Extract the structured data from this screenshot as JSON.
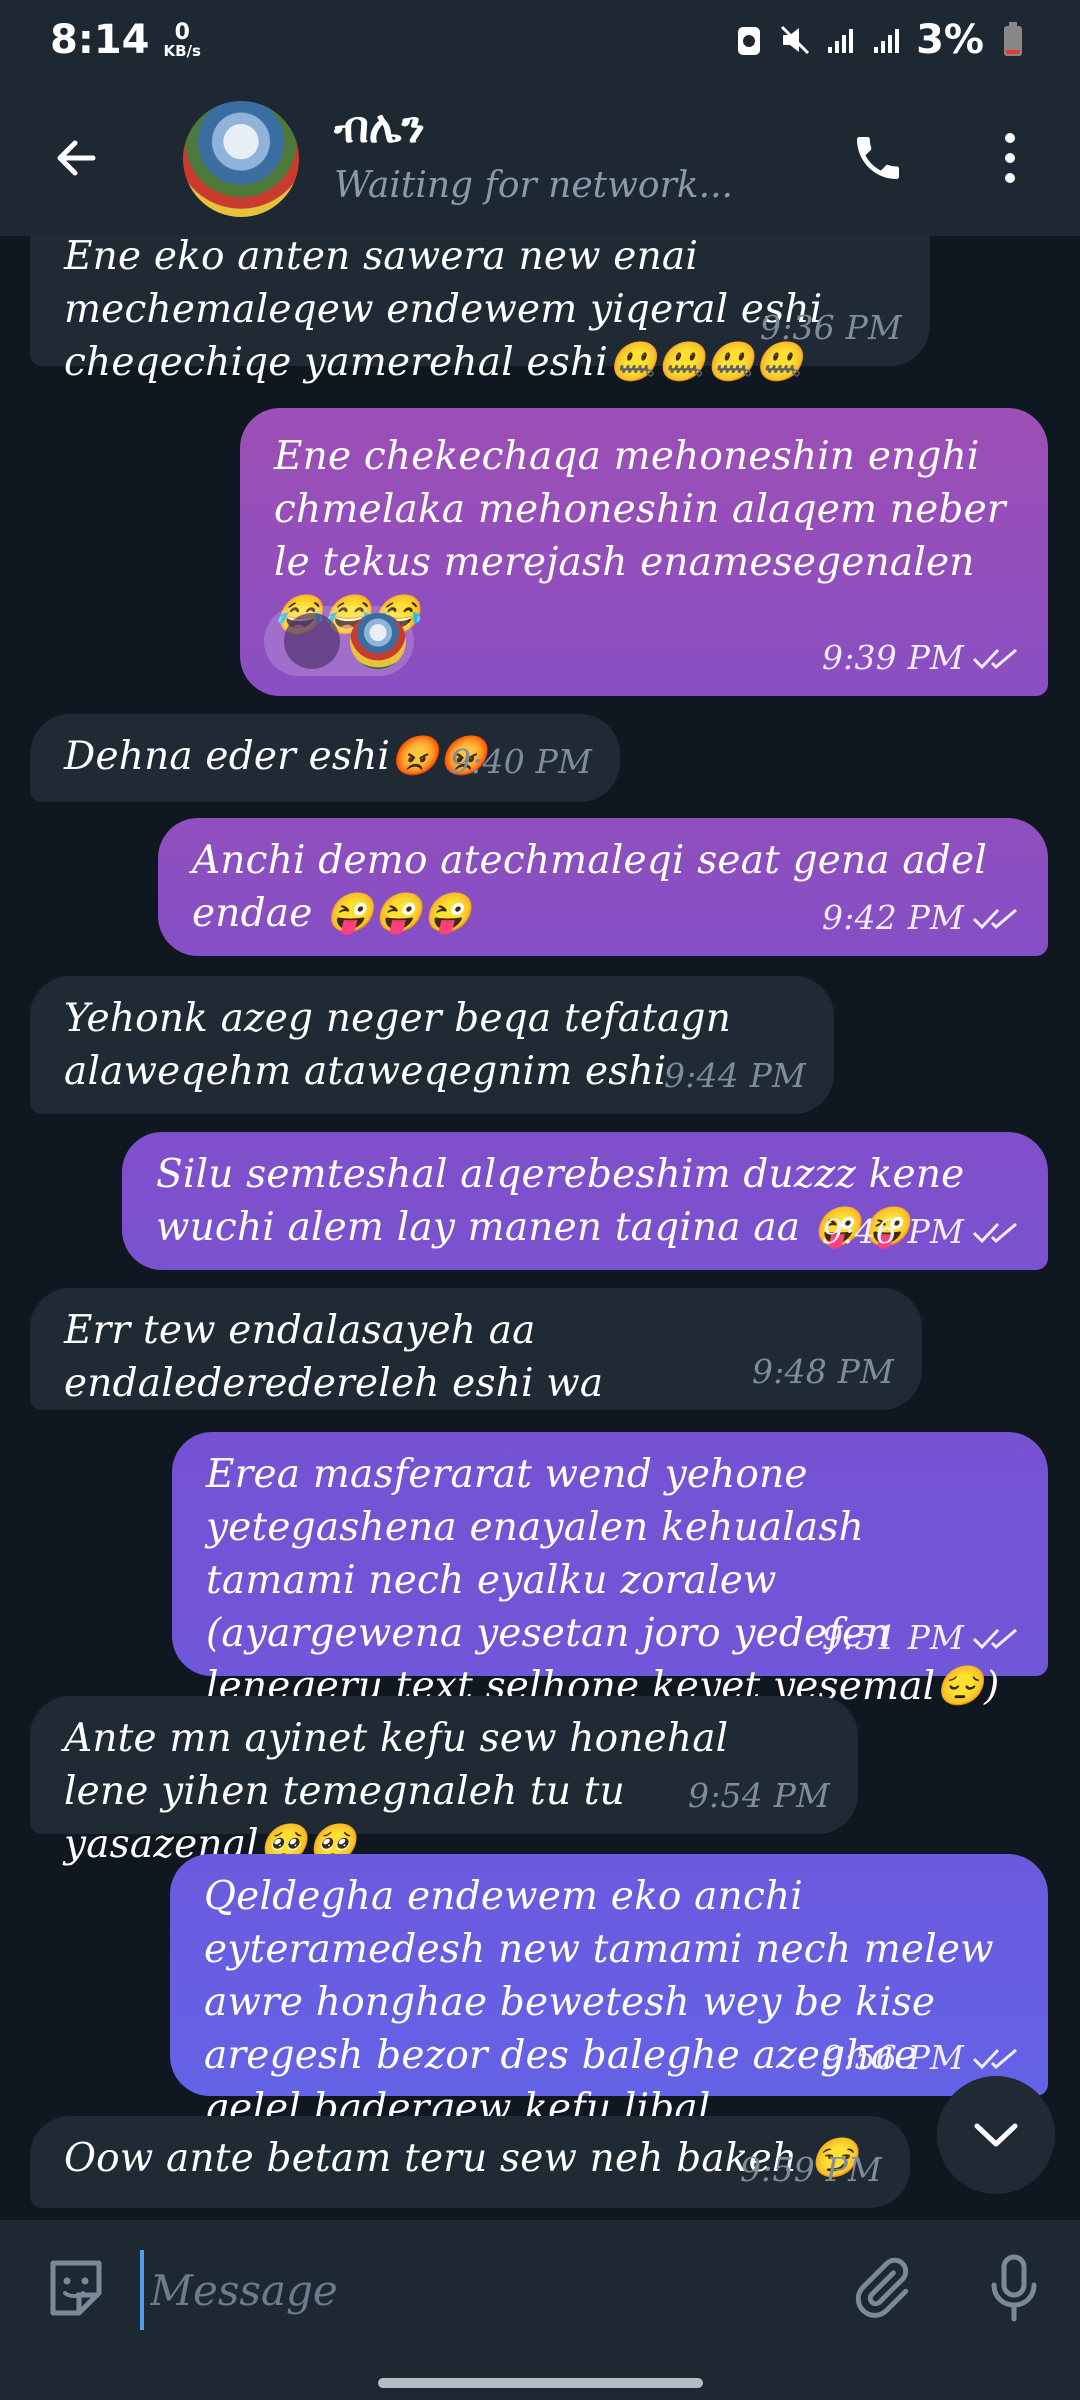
{
  "status_bar": {
    "time": "8:14",
    "speed_value": "0",
    "speed_unit": "KB/s",
    "battery": "3%"
  },
  "header": {
    "contact_name": "ብሌን",
    "status": "Waiting for network..."
  },
  "messages": [
    {
      "dir": "in",
      "text": "Ene eko anten sawera new enai mechemaleqew endewem yiqeral eshi cheqechiqe yamerehal eshi🤐🤐🤐🤐",
      "time": "9:36 PM"
    },
    {
      "dir": "out",
      "text": "Ene chekechaqa mehoneshin enghi chmelaka mehoneshin alaqem neber le tekus merejash enamesegenalen 😂😂😂",
      "time": "9:39 PM"
    },
    {
      "dir": "in",
      "text": "Dehna eder eshi😡😡",
      "time": "9:40 PM"
    },
    {
      "dir": "out",
      "text": "Anchi demo atechmaleqi seat gena adel endae 😜😜😜",
      "time": "9:42 PM"
    },
    {
      "dir": "in",
      "text": "Yehonk azeg neger beqa tefatagn alaweqehm ataweqegnim eshi",
      "time": "9:44 PM"
    },
    {
      "dir": "out",
      "text": "Silu semteshal alqerebeshim duzzz kene wuchi alem lay manen taqina aa 😜😜",
      "time": "9:46 PM"
    },
    {
      "dir": "in",
      "text": "Err tew endalasayeh aa endalederedereleh eshi wa",
      "time": "9:48 PM"
    },
    {
      "dir": "out",
      "text": "Erea masferarat wend yehone yetegashena enayalen kehualash tamami nech eyalku zoralew (ayargewena yesetan joro yedefen lenegeru text selhone keyet yesemal😔)",
      "time": "9:51 PM"
    },
    {
      "dir": "in",
      "text": "Ante mn ayinet kefu sew honehal lene yihen temegnaleh tu tu yasazenal🥺🥺",
      "time": "9:54 PM"
    },
    {
      "dir": "out",
      "text": "Qeldegha endewem eko anchi eyteramedesh new tamami nech melew awre honghae bewetesh wey be kise aregesh bezor des baleghe azeghae qelel badergew kefu libal",
      "time": "9:56 PM"
    },
    {
      "dir": "in",
      "text": "Oow ante betam teru sew neh bakeh 😏",
      "time": "9:59 PM"
    }
  ],
  "composer": {
    "placeholder": "Message"
  },
  "colors": {
    "background": "#0f1720",
    "header": "#1e2833",
    "incoming_bubble": "#1f2a35",
    "outgoing_gradient_top": "#9c4fb3",
    "outgoing_gradient_bottom": "#6a64e6",
    "accent": "#4e9ee8"
  }
}
